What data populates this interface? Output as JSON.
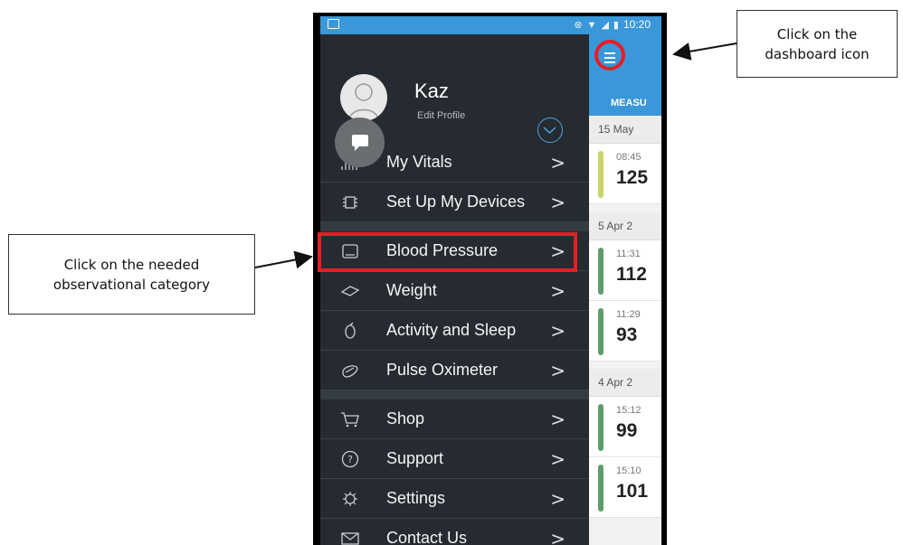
{
  "annotations": {
    "left": "Click on the needed\nobservational category",
    "right": "Click on the\ndashboard icon"
  },
  "status_bar": {
    "time": "10:20"
  },
  "profile": {
    "name": "Kaz",
    "edit_label": "Edit Profile"
  },
  "menu": {
    "group1": [
      {
        "label": "My Vitals",
        "icon": "vitals-icon"
      },
      {
        "label": "Set Up My Devices",
        "icon": "chip-icon"
      },
      {
        "label": "Blood Pressure",
        "icon": "tablet-icon"
      },
      {
        "label": "Weight",
        "icon": "scale-icon"
      },
      {
        "label": "Activity and Sleep",
        "icon": "watch-icon"
      },
      {
        "label": "Pulse Oximeter",
        "icon": "oximeter-icon"
      }
    ],
    "group2": [
      {
        "label": "Shop",
        "icon": "cart-icon"
      },
      {
        "label": "Support",
        "icon": "question-icon"
      },
      {
        "label": "Settings",
        "icon": "gear-icon"
      },
      {
        "label": "Contact Us",
        "icon": "mail-icon"
      }
    ],
    "chevron": ">"
  },
  "content": {
    "tab_label": "MEASU",
    "dates": [
      "15 May",
      "5 Apr 2",
      "4 Apr 2"
    ],
    "readings": [
      {
        "time": "08:45",
        "value": "125",
        "color": "#c9d468"
      },
      {
        "time": "11:31",
        "value": "112",
        "color": "#5e9c6c"
      },
      {
        "time": "11:29",
        "value": "93",
        "color": "#5e9c6c"
      },
      {
        "time": "15:12",
        "value": "99",
        "color": "#5e9c6c"
      },
      {
        "time": "15:10",
        "value": "101",
        "color": "#5e9c6c"
      }
    ]
  },
  "colors": {
    "accent": "#3a97d8",
    "drawer": "#262b31",
    "highlight": "#e41e26"
  }
}
